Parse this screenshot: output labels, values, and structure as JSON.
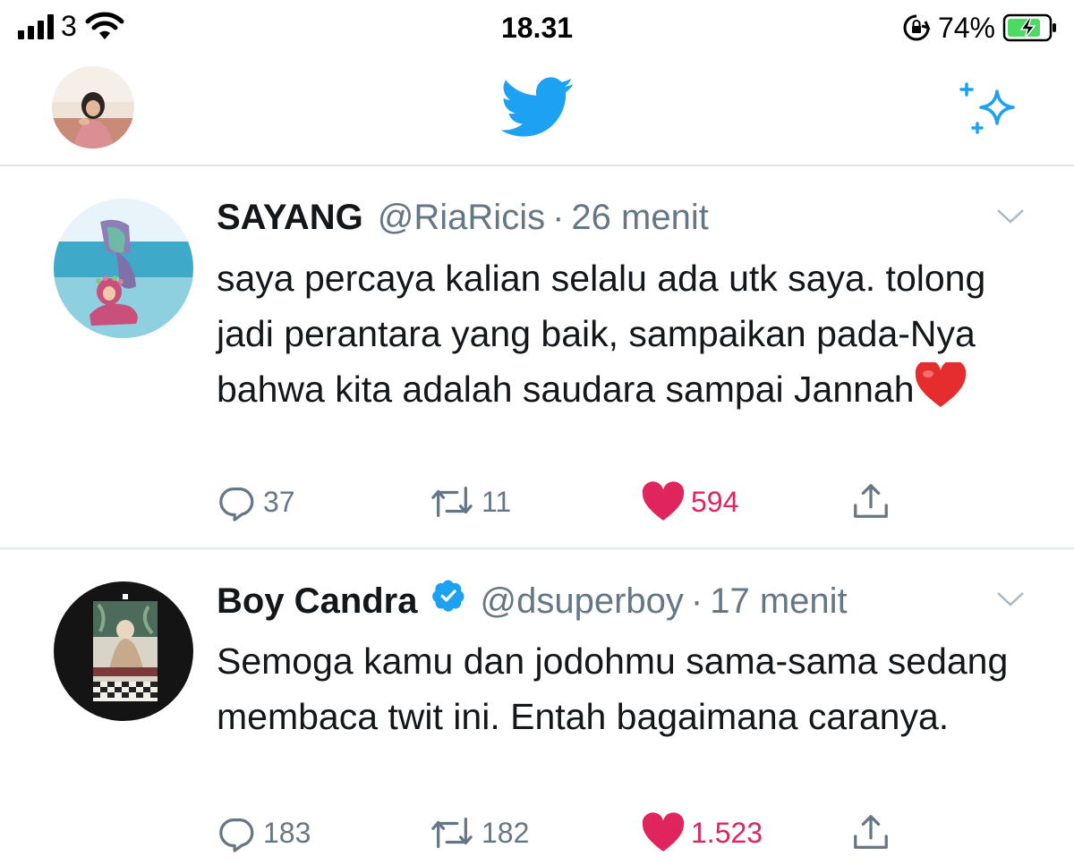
{
  "status_bar": {
    "carrier": "3",
    "time": "18.31",
    "battery_percent": "74%"
  },
  "header": {
    "logo": "twitter-bird-icon",
    "right_icon": "sparkle-icon"
  },
  "colors": {
    "twitter_blue": "#1da1f2",
    "like_red": "#e0245e",
    "secondary_text": "#657786",
    "divider": "#e1e8ed",
    "battery_green": "#4cd964"
  },
  "tweets": [
    {
      "name": "SAYANG",
      "handle": "@RiaRicis",
      "separator": "·",
      "time": "26 menit",
      "text": "saya percaya kalian selalu ada utk saya. tolong jadi perantara yang baik, sampaikan pada-Nya bahwa kita adalah saudara sampai Jannah",
      "emoji": "❤️",
      "replies": "37",
      "retweets": "11",
      "likes": "594",
      "liked": true
    },
    {
      "name": "Boy Candra",
      "verified": true,
      "handle": "@dsuperboy",
      "separator": "·",
      "time": "17 menit",
      "text": "Semoga kamu dan jodohmu sama-sama sedang membaca twit ini. Entah bagaimana caranya.",
      "replies": "183",
      "retweets": "182",
      "likes": "1.523",
      "liked": true
    }
  ]
}
